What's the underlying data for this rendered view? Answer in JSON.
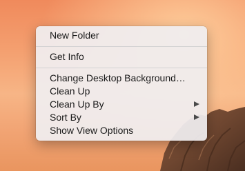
{
  "context_menu": {
    "group1": [
      {
        "label": "New Folder"
      }
    ],
    "group2": [
      {
        "label": "Get Info"
      }
    ],
    "group3": [
      {
        "label": "Change Desktop Background…",
        "submenu": false
      },
      {
        "label": "Clean Up",
        "submenu": false
      },
      {
        "label": "Clean Up By",
        "submenu": true
      },
      {
        "label": "Sort By",
        "submenu": true
      },
      {
        "label": "Show View Options",
        "submenu": false
      }
    ]
  },
  "colors": {
    "menu_background": "#f0eef0",
    "text": "#1a1a1a",
    "separator": "#d3d2d3",
    "desktop_top": "#f08a5c",
    "desktop_bottom": "#e9955f"
  }
}
